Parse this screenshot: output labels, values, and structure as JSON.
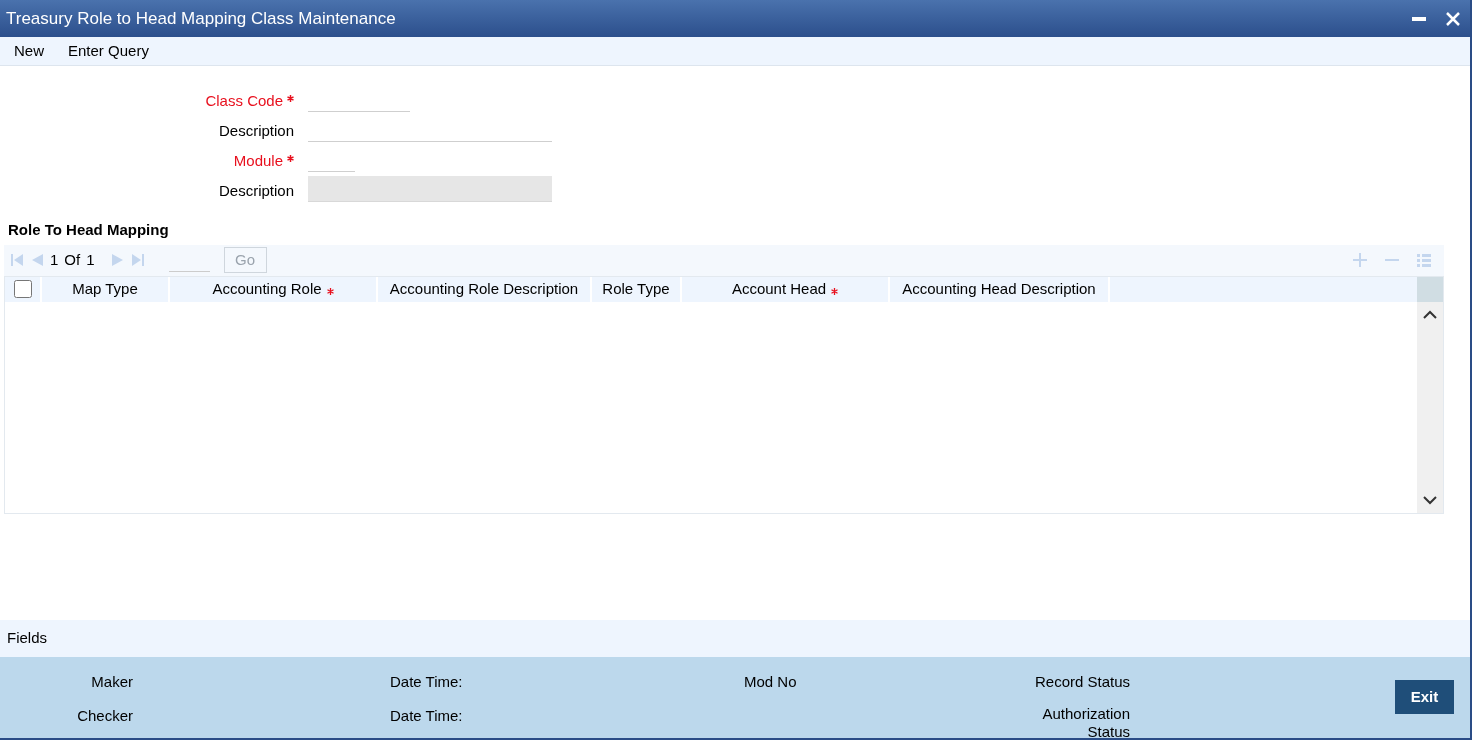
{
  "window": {
    "title": "Treasury Role to Head Mapping Class Maintenance"
  },
  "toolbar": [
    "New",
    "Enter Query"
  ],
  "form": [
    {
      "label": "Class Code",
      "required": true,
      "kind": "short",
      "disabled": false
    },
    {
      "label": "Description",
      "required": false,
      "kind": "long",
      "disabled": false
    },
    {
      "label": "Module",
      "required": true,
      "kind": "tiny",
      "disabled": false
    },
    {
      "label": "Description",
      "required": false,
      "kind": "long",
      "disabled": true
    }
  ],
  "section": {
    "title": "Role To Head Mapping"
  },
  "pager": {
    "current": "1",
    "of": "Of",
    "total": "1",
    "go": "Go"
  },
  "table": {
    "select_all": {
      "checked": false
    },
    "columns": [
      {
        "label": "Map Type",
        "required": false
      },
      {
        "label": "Accounting Role",
        "required": true
      },
      {
        "label": "Accounting Role Description",
        "required": false
      },
      {
        "label": "Role Type",
        "required": false
      },
      {
        "label": "Account Head",
        "required": true
      },
      {
        "label": "Accounting Head Description",
        "required": false
      }
    ]
  },
  "fields_bar": {
    "label": "Fields"
  },
  "footer": {
    "maker": "Maker",
    "checker": "Checker",
    "date_time_1": "Date Time:",
    "date_time_2": "Date Time:",
    "mod_no": "Mod No",
    "record_status": "Record Status",
    "authorization_status": "Authorization Status",
    "exit": "Exit"
  }
}
